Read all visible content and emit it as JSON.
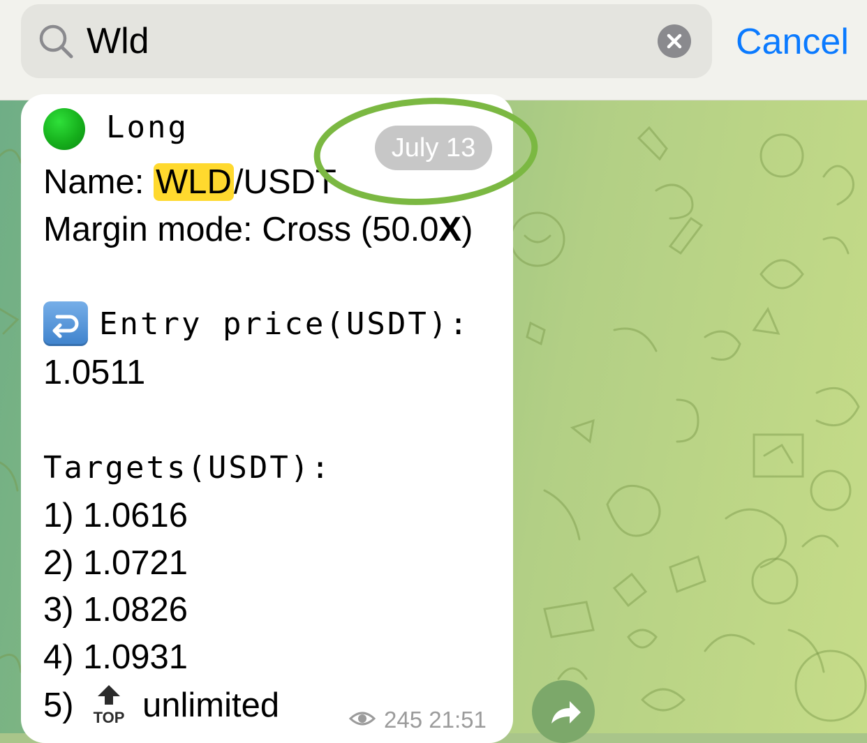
{
  "search": {
    "query": "Wld",
    "cancel_label": "Cancel"
  },
  "message": {
    "direction": "Long",
    "name_label": "Name: ",
    "name_highlight": "WLD",
    "name_rest": "/USDT",
    "margin_prefix": "Margin mode: Cross (50.0",
    "margin_bold": "X",
    "margin_suffix": ")",
    "entry_label": "Entry price(USDT):",
    "entry_value": "1.0511",
    "targets_label": "Targets(USDT):",
    "targets": [
      "1) 1.0616",
      "2) 1.0721",
      "3) 1.0826",
      "4) 1.0931"
    ],
    "target5_prefix": "5)",
    "top_icon_text": "TOP",
    "target5_value": "unlimited",
    "views": "245",
    "time": "21:51"
  },
  "date_label": "July 13",
  "colors": {
    "accent": "#0a7aff",
    "highlight": "#ffd92e",
    "long_indicator": "#16b01c",
    "annotation_ring": "#7bb842"
  }
}
